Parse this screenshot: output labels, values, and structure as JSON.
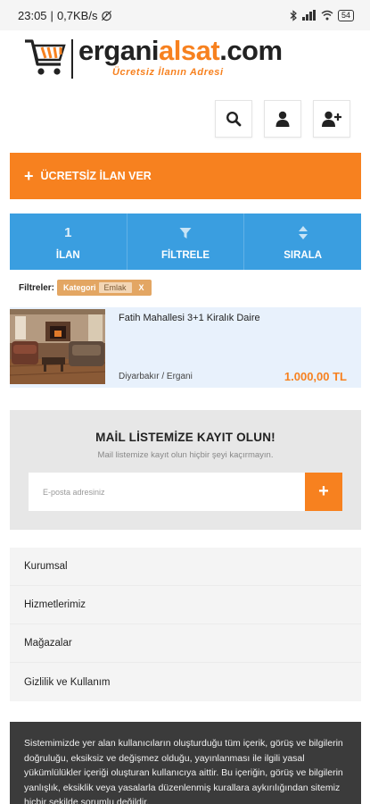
{
  "status_bar": {
    "time": "23:05",
    "speed": "0,7KB/s",
    "battery": "54"
  },
  "logo": {
    "brand_part1": "ergani",
    "brand_part2": "alsat",
    "brand_part3": ".com",
    "tagline": "Ücretsiz İlanın Adresi"
  },
  "header_icons": [
    "search-icon",
    "user-icon",
    "add-user-icon"
  ],
  "cta": {
    "label": "ÜCRETSİZ İLAN VER"
  },
  "tabs": [
    {
      "top": "1",
      "label": "İLAN"
    },
    {
      "top": "",
      "label": "FİLTRELE",
      "icon": "filter-icon"
    },
    {
      "top": "",
      "label": "SIRALA",
      "icon": "sort-icon"
    }
  ],
  "filters": {
    "label": "Filtreler:",
    "chip_key": "Kategori",
    "chip_value": "Emlak",
    "chip_remove": "X"
  },
  "listing": {
    "title": "Fatih Mahallesi 3+1 Kiralık Daire",
    "location": "Diyarbakır / Ergani",
    "price": "1.000,00 TL"
  },
  "newsletter": {
    "heading": "MAİL LİSTEMİZE KAYIT OLUN!",
    "subtext": "Mail listemize kayıt olun hiçbir şeyi kaçırmayın.",
    "placeholder": "E-posta adresiniz",
    "submit": "+"
  },
  "links": [
    "Kurumsal",
    "Hizmetlerimiz",
    "Mağazalar",
    "Gizlilik ve Kullanım"
  ],
  "footer": {
    "text": "Sistemimizde yer alan kullanıcıların oluşturduğu tüm içerik, görüş ve bilgilerin doğruluğu, eksiksiz ve değişmez olduğu, yayınlanması ile ilgili yasal yükümlülükler içeriği oluşturan kullanıcıya aittir. Bu içeriğin, görüş ve bilgilerin yanlışlık, eksiklik veya yasalarla düzenlenmiş kurallara aykırılığından sitemiz hiçbir şekilde sorumlu değildir."
  },
  "colors": {
    "accent": "#f7811f",
    "tab_blue": "#3a9ee0",
    "listing_bg": "#e8f1fc",
    "footer_bg": "#3b3b3b"
  }
}
